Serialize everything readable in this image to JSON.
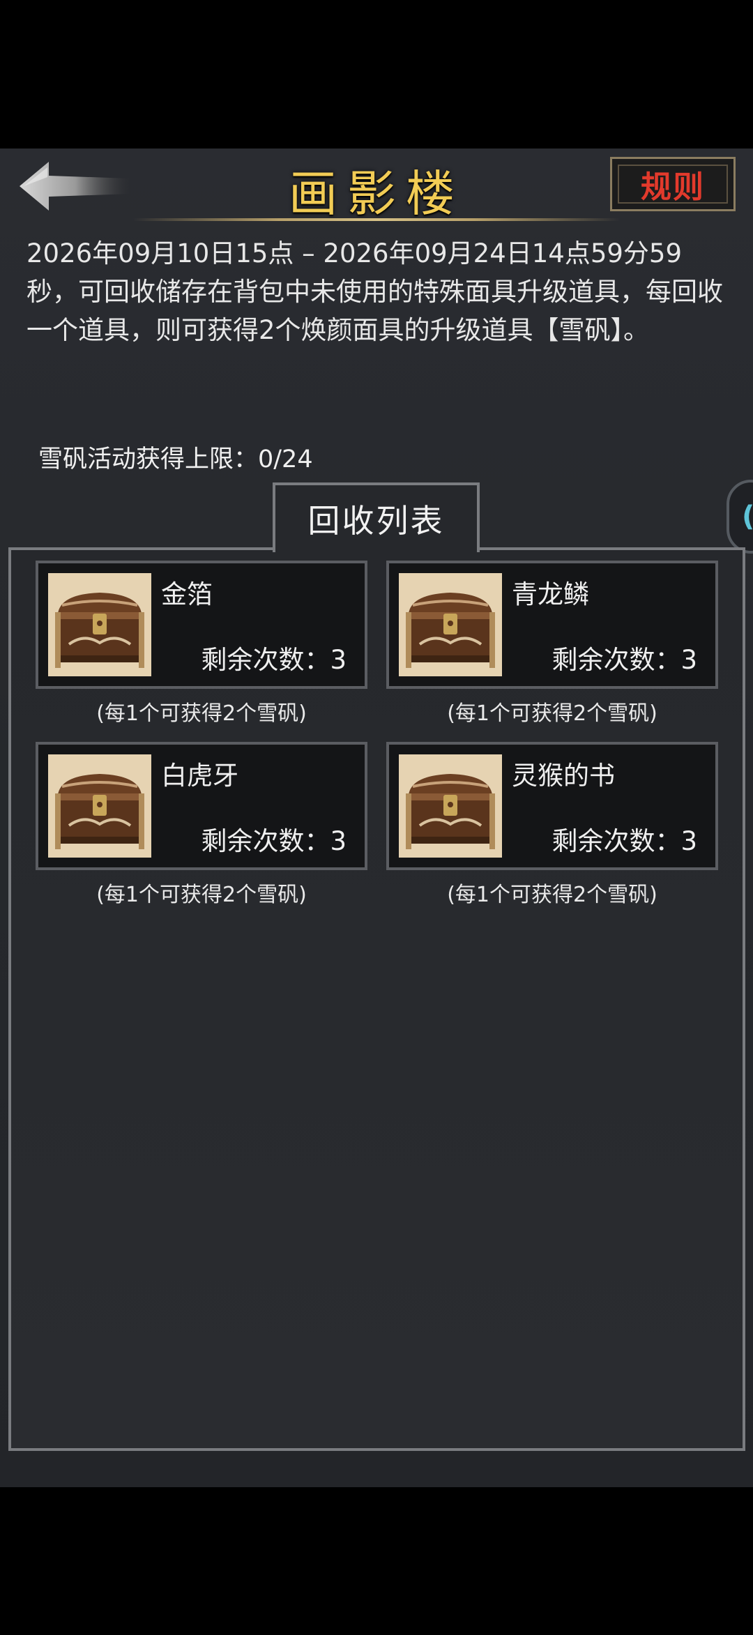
{
  "header": {
    "title": "画影楼",
    "rules_label": "规则"
  },
  "description": "2026年09月10日15点 – 2026年09月24日14点59分59秒，可回收储存在背包中未使用的特殊面具升级道具，每回收一个道具，则可获得2个焕颜面具的升级道具【雪矾】。",
  "limit_label": "雪矾活动获得上限：0/24",
  "side_tab_glyph": "(",
  "panel": {
    "tab_label": "回收列表",
    "items": [
      {
        "name": "金箔",
        "count_label": "剩余次数：3",
        "hint": "(每1个可获得2个雪矾)"
      },
      {
        "name": "青龙鳞",
        "count_label": "剩余次数：3",
        "hint": "(每1个可获得2个雪矾)"
      },
      {
        "name": "白虎牙",
        "count_label": "剩余次数：3",
        "hint": "(每1个可获得2个雪矾)"
      },
      {
        "name": "灵猴的书",
        "count_label": "剩余次数：3",
        "hint": "(每1个可获得2个雪矾)"
      }
    ]
  },
  "icons": {
    "back": "back-arrow-icon",
    "item": "treasure-chest-icon"
  },
  "colors": {
    "title": "#f2cc55",
    "rules": "#e23a2c",
    "side_tab": "#5ec4d8"
  }
}
